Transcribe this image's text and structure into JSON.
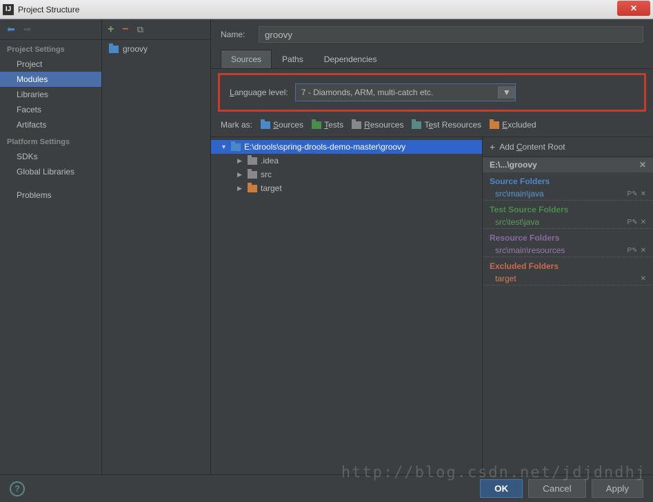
{
  "window": {
    "title": "Project Structure"
  },
  "sidebar": {
    "section1": "Project Settings",
    "items1": [
      "Project",
      "Modules",
      "Libraries",
      "Facets",
      "Artifacts"
    ],
    "section2": "Platform Settings",
    "items2": [
      "SDKs",
      "Global Libraries"
    ],
    "problems": "Problems"
  },
  "module": {
    "name": "groovy"
  },
  "nameLabel": "Name:",
  "tabs": [
    "Sources",
    "Paths",
    "Dependencies"
  ],
  "langLevel": {
    "label": "Language level:",
    "value": "7 - Diamonds, ARM, multi-catch etc."
  },
  "markAs": {
    "label": "Mark as:",
    "sources": "Sources",
    "tests": "Tests",
    "resources": "Resources",
    "testResources": "Test Resources",
    "excluded": "Excluded"
  },
  "tree": {
    "root": "E:\\drools\\spring-drools-demo-master\\groovy",
    "children": [
      ".idea",
      "src",
      "target"
    ]
  },
  "roots": {
    "addLabel": "Add Content Root",
    "path": "E:\\...\\groovy",
    "sections": [
      {
        "title": "Source Folders",
        "cls": "src",
        "items": [
          "src\\main\\java"
        ],
        "actions": true
      },
      {
        "title": "Test Source Folders",
        "cls": "test",
        "items": [
          "src\\test\\java"
        ],
        "actions": true
      },
      {
        "title": "Resource Folders",
        "cls": "res",
        "items": [
          "src\\main\\resources"
        ],
        "actions": true
      },
      {
        "title": "Excluded Folders",
        "cls": "exc",
        "items": [
          "target"
        ],
        "actions": false
      }
    ]
  },
  "footer": {
    "ok": "OK",
    "cancel": "Cancel",
    "apply": "Apply"
  },
  "watermark": "http://blog.csdn.net/jdjdndhj"
}
